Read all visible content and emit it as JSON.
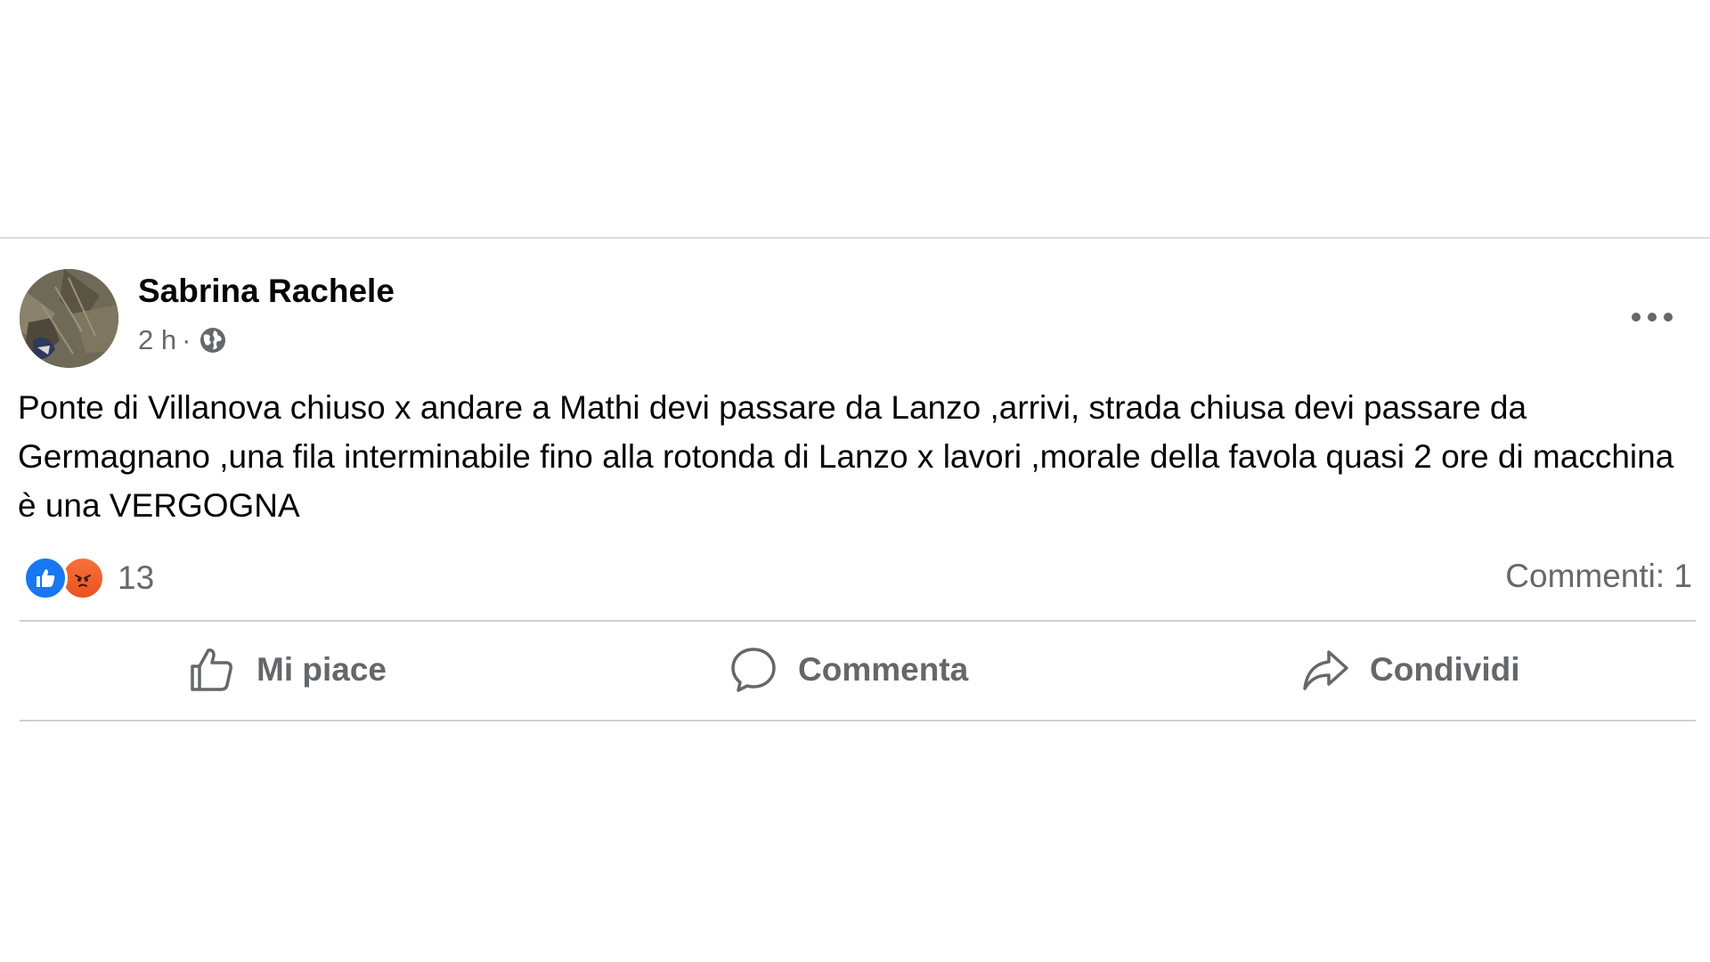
{
  "post": {
    "author": "Sabrina Rachele",
    "time": "2 h",
    "separator": "·",
    "audience_icon": "globe-icon",
    "more_icon": "more-options-icon",
    "text": "Ponte di Villanova chiuso x andare a Mathi devi passare da Lanzo ,arrivi, strada chiusa devi passare da Germagnano ,una fila interminabile fino alla rotonda di Lanzo x lavori ,morale della favola quasi 2 ore di macchina è una VERGOGNA",
    "reactions": {
      "types": [
        "like",
        "angry"
      ],
      "count": "13",
      "like_color": "#1877f2",
      "angry_color": "#e9531d"
    },
    "comments_label": "Commenti: 1",
    "actions": {
      "like": "Mi piace",
      "comment": "Commenta",
      "share": "Condividi"
    }
  },
  "colors": {
    "text_primary": "#050505",
    "text_secondary": "#65676b",
    "divider": "#ced0d4"
  }
}
